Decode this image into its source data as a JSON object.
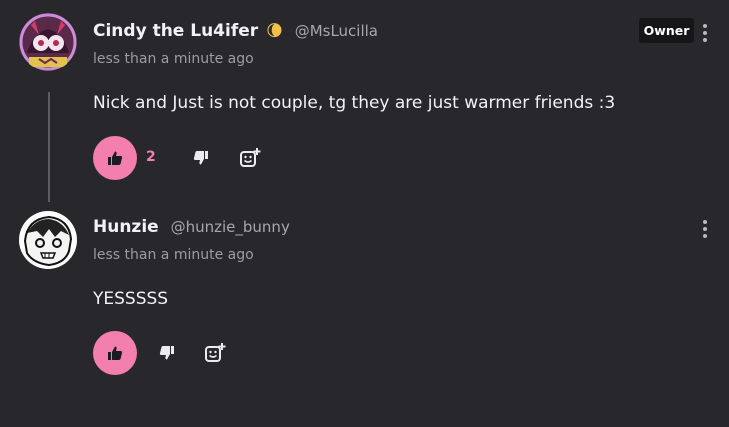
{
  "comments": [
    {
      "author": "Cindy the Lu4ifer",
      "author_emoji": "🌘",
      "handle": "@MsLucilla",
      "time": "less than a minute ago",
      "badge": "Owner",
      "text": "Nick and Just is not couple, tg they are just warmer friends :3",
      "likes": "2"
    },
    {
      "author": "Hunzie",
      "handle": "@hunzie_bunny",
      "time": "less than a minute ago",
      "text": "YESSSSS"
    }
  ],
  "icons": {
    "like": "thumbs-up-icon",
    "dislike": "thumbs-down-icon",
    "react": "add-reaction-icon",
    "more": "more-vertical-icon"
  },
  "colors": {
    "background": "#27272c",
    "accent": "#f37fae",
    "badge_bg": "#161618"
  }
}
